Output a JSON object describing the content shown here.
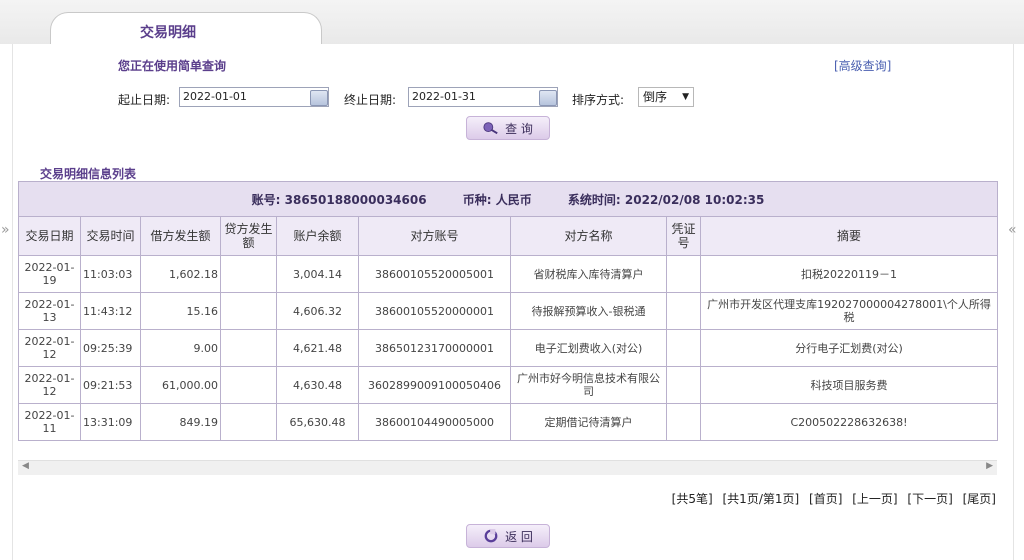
{
  "tab": {
    "title": "交易明细"
  },
  "query": {
    "mode_text": "您正在使用简单查询",
    "advanced_link": "[高级查询]",
    "start_label": "起止日期:",
    "start_value": "2022-01-01",
    "end_label": "终止日期:",
    "end_value": "2022-01-31",
    "sort_label": "排序方式:",
    "sort_value": "倒序",
    "search_button": "查 询"
  },
  "list": {
    "title": "交易明细信息列表",
    "account_info": "账号: 38650188000034606",
    "currency_info": "币种: 人民币",
    "time_info": "系统时间: 2022/02/08 10:02:35",
    "columns": [
      "交易日期",
      "交易时间",
      "借方发生额",
      "贷方发生额",
      "账户余额",
      "对方账号",
      "对方名称",
      "凭证号",
      "摘要"
    ],
    "rows": [
      [
        "2022-01-19",
        "11:03:03",
        "1,602.18",
        "",
        "3,004.14",
        "38600105520005001",
        "省财税库入库待清算户",
        "",
        "扣税20220119－1"
      ],
      [
        "2022-01-13",
        "11:43:12",
        "15.16",
        "",
        "4,606.32",
        "38600105520000001",
        "待报解预算收入-银税通",
        "",
        "广州市开发区代理支库192027000004278001\\个人所得税"
      ],
      [
        "2022-01-12",
        "09:25:39",
        "9.00",
        "",
        "4,621.48",
        "38650123170000001",
        "电子汇划费收入(对公)",
        "",
        "分行电子汇划费(对公)"
      ],
      [
        "2022-01-12",
        "09:21:53",
        "61,000.00",
        "",
        "4,630.48",
        "3602899009100050406",
        "广州市好今明信息技术有限公司",
        "",
        "科技项目服务费"
      ],
      [
        "2022-01-11",
        "13:31:09",
        "849.19",
        "",
        "65,630.48",
        "38600104490005000",
        "定期借记待清算户",
        "",
        "C200502228632638!"
      ]
    ]
  },
  "pager": {
    "total": "[共5笔]",
    "pages": "[共1页/第1页]",
    "first": "[首页]",
    "prev": "[上一页]",
    "next": "[下一页]",
    "last": "[尾页]"
  },
  "back_button": "返 回",
  "side": {
    "left": "»",
    "right": "«"
  }
}
